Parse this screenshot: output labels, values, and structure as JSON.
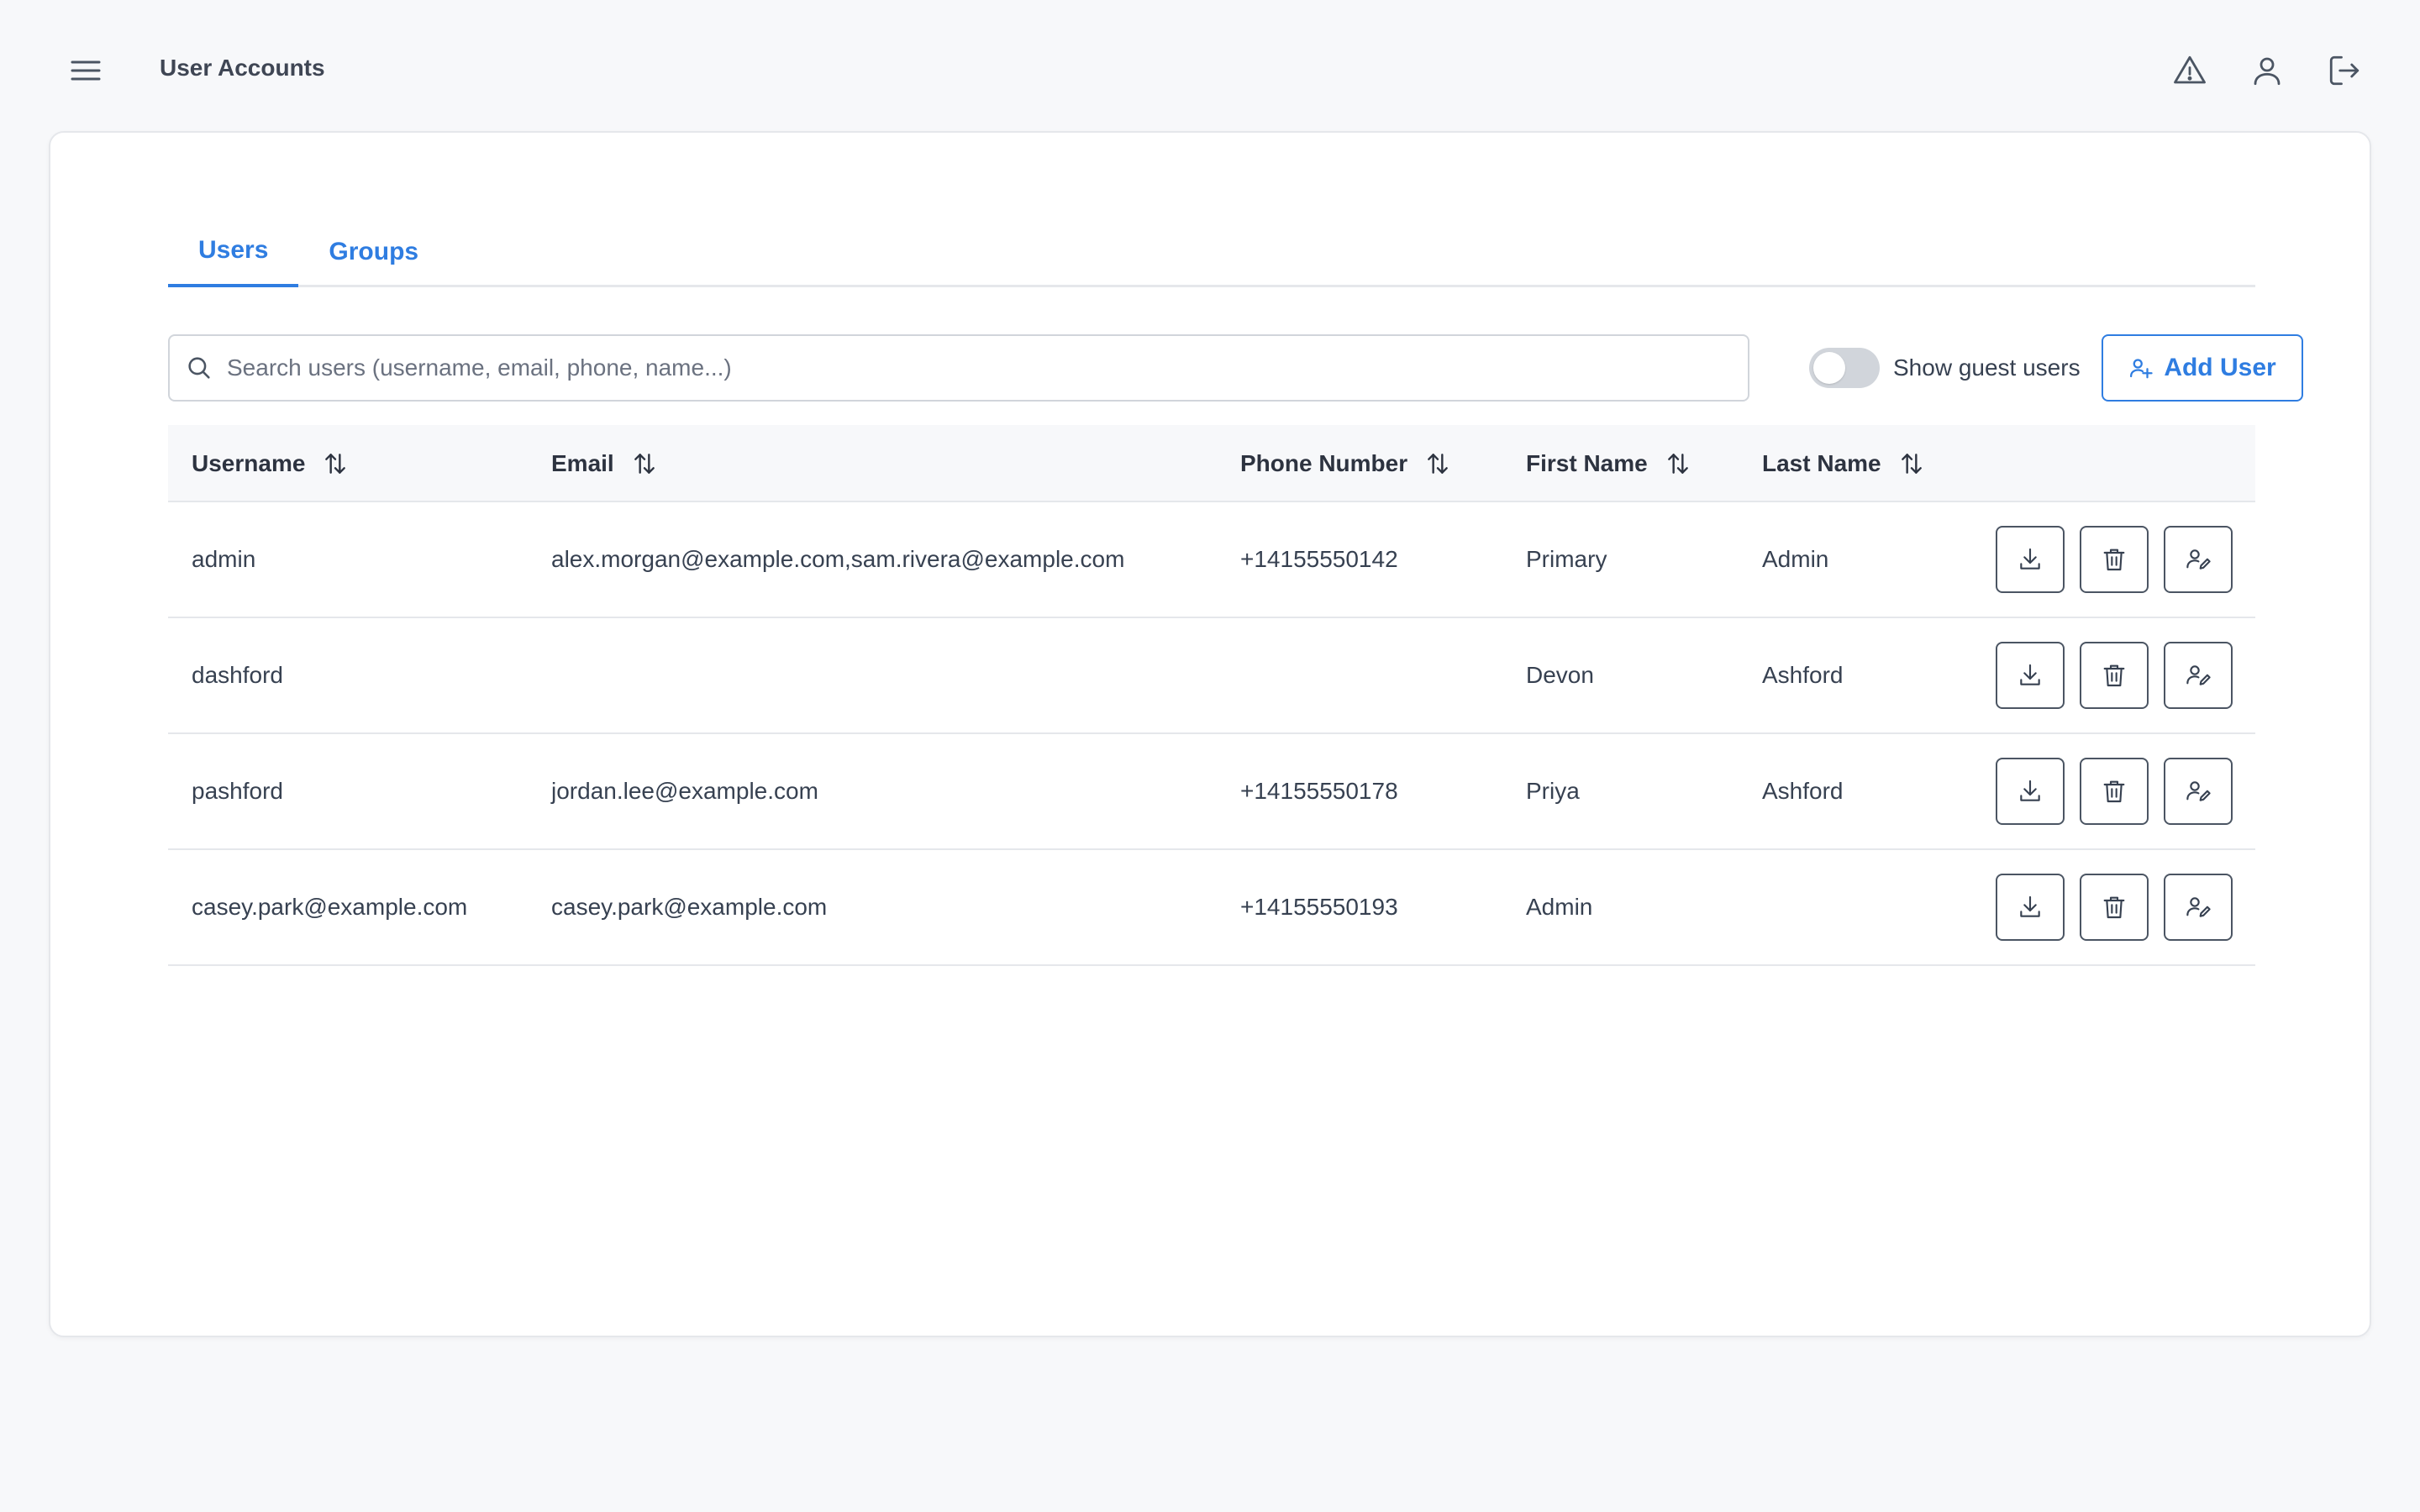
{
  "header": {
    "title": "User Accounts",
    "icons": [
      "menu-icon",
      "alert-icon",
      "user-icon",
      "logout-icon"
    ]
  },
  "tabs": [
    {
      "label": "Users",
      "active": true
    },
    {
      "label": "Groups",
      "active": false
    }
  ],
  "toolbar": {
    "search_placeholder": "Search users (username, email, phone, name...)",
    "search_value": "",
    "guest_toggle_label": "Show guest users",
    "guest_toggle_on": false,
    "add_button_label": "Add User"
  },
  "table": {
    "columns": [
      "Username",
      "Email",
      "Phone Number",
      "First Name",
      "Last Name"
    ],
    "rows": [
      {
        "username": "admin",
        "email": "alex.morgan@example.com,sam.rivera@example.com",
        "phone": "+14155550142",
        "first": "Primary",
        "last": "Admin"
      },
      {
        "username": "dashford",
        "email": "",
        "phone": "",
        "first": "Devon",
        "last": "Ashford"
      },
      {
        "username": "pashford",
        "email": "jordan.lee@example.com",
        "phone": "+14155550178",
        "first": "Priya",
        "last": "Ashford"
      },
      {
        "username": "casey.park@example.com",
        "email": "casey.park@example.com",
        "phone": "+14155550193",
        "first": "Admin",
        "last": ""
      }
    ],
    "row_actions": [
      "download-icon",
      "trash-icon",
      "edit-user-icon"
    ]
  },
  "colors": {
    "accent": "#2f7de1",
    "background": "#f7f8fa",
    "border": "#e5e7eb",
    "text": "#374151"
  }
}
